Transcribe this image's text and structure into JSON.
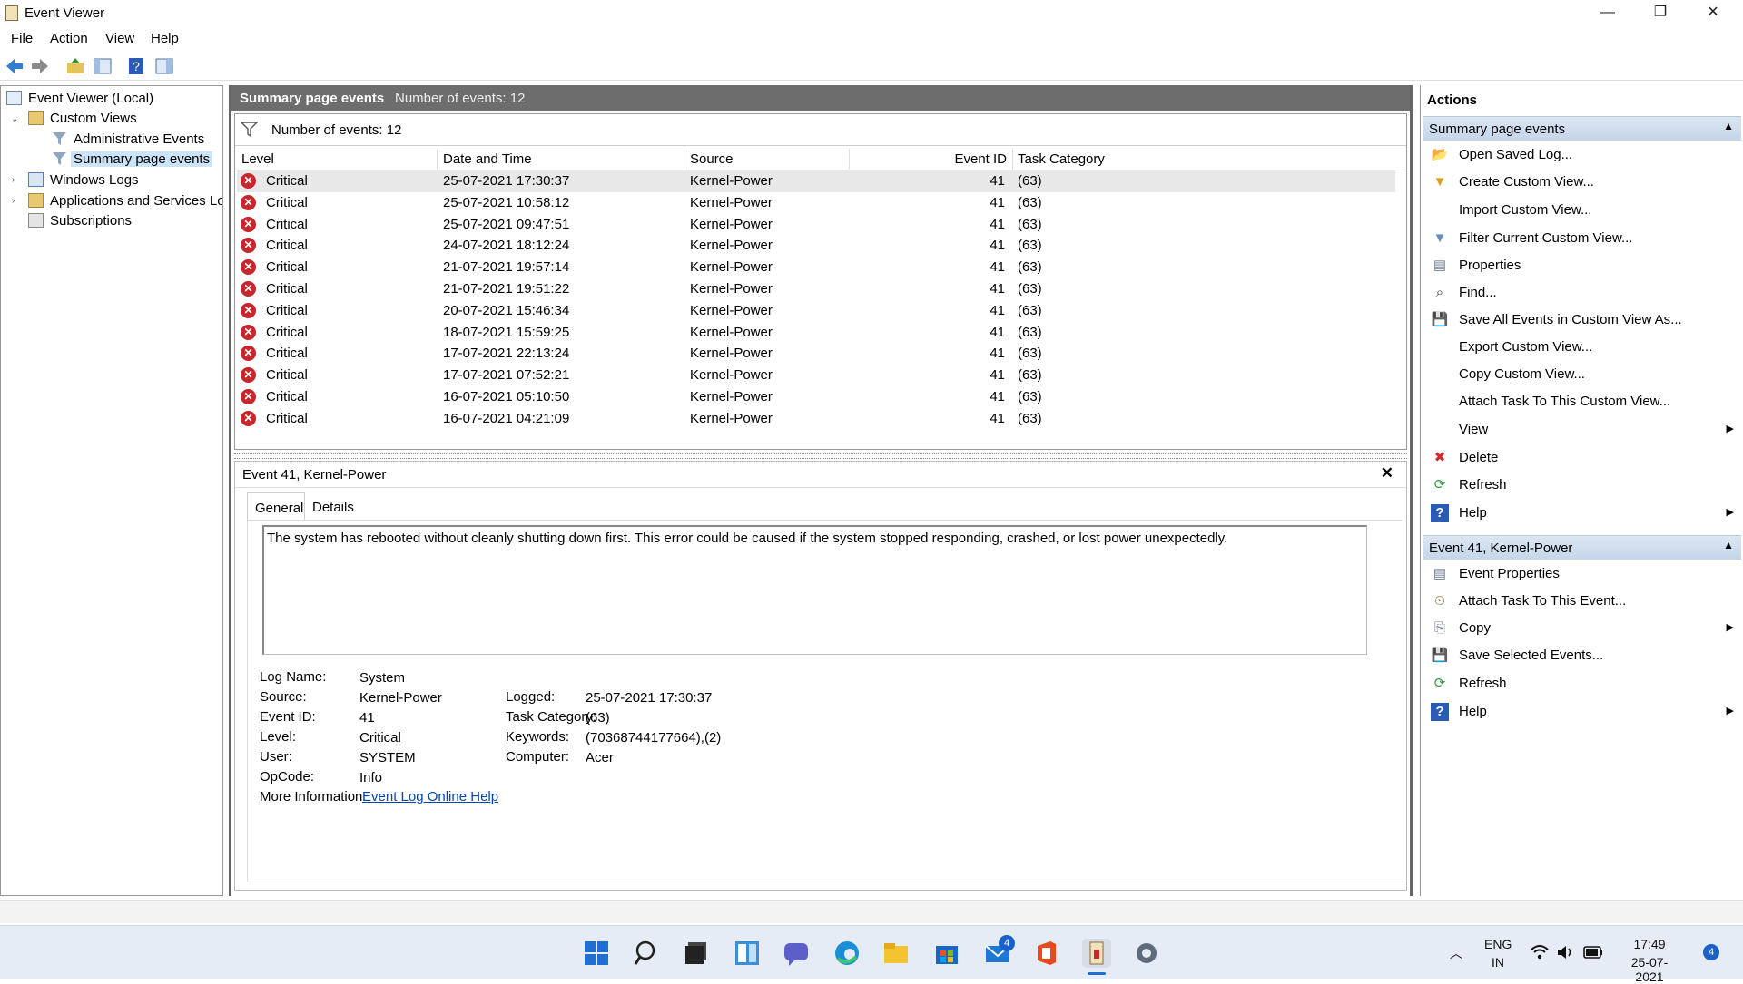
{
  "window": {
    "title": "Event Viewer",
    "controls": {
      "minimize": "—",
      "maximize": "❐",
      "close": "✕"
    }
  },
  "menu": [
    "File",
    "Action",
    "View",
    "Help"
  ],
  "tree": {
    "root": "Event Viewer (Local)",
    "custom_views": "Custom Views",
    "admin_events": "Administrative Events",
    "summary_events": "Summary page events",
    "windows_logs": "Windows Logs",
    "apps_services": "Applications and Services Logs",
    "subscriptions": "Subscriptions"
  },
  "center": {
    "header_title": "Summary page events",
    "header_count": "Number of events: 12",
    "filter_label": "Number of events: 12",
    "columns": [
      "Level",
      "Date and Time",
      "Source",
      "Event ID",
      "Task Category"
    ],
    "rows": [
      [
        "Critical",
        "25-07-2021 17:30:37",
        "Kernel-Power",
        "41",
        "(63)"
      ],
      [
        "Critical",
        "25-07-2021 10:58:12",
        "Kernel-Power",
        "41",
        "(63)"
      ],
      [
        "Critical",
        "25-07-2021 09:47:51",
        "Kernel-Power",
        "41",
        "(63)"
      ],
      [
        "Critical",
        "24-07-2021 18:12:24",
        "Kernel-Power",
        "41",
        "(63)"
      ],
      [
        "Critical",
        "21-07-2021 19:57:14",
        "Kernel-Power",
        "41",
        "(63)"
      ],
      [
        "Critical",
        "21-07-2021 19:51:22",
        "Kernel-Power",
        "41",
        "(63)"
      ],
      [
        "Critical",
        "20-07-2021 15:46:34",
        "Kernel-Power",
        "41",
        "(63)"
      ],
      [
        "Critical",
        "18-07-2021 15:59:25",
        "Kernel-Power",
        "41",
        "(63)"
      ],
      [
        "Critical",
        "17-07-2021 22:13:24",
        "Kernel-Power",
        "41",
        "(63)"
      ],
      [
        "Critical",
        "17-07-2021 07:52:21",
        "Kernel-Power",
        "41",
        "(63)"
      ],
      [
        "Critical",
        "16-07-2021 05:10:50",
        "Kernel-Power",
        "41",
        "(63)"
      ],
      [
        "Critical",
        "16-07-2021 04:21:09",
        "Kernel-Power",
        "41",
        "(63)"
      ]
    ]
  },
  "detail": {
    "title": "Event 41, Kernel-Power",
    "tabs": [
      "General",
      "Details"
    ],
    "description": "The system has rebooted without cleanly shutting down first. This error could be caused if the system stopped responding, crashed, or lost power unexpectedly.",
    "fields": {
      "log_name_label": "Log Name:",
      "log_name": "System",
      "source_label": "Source:",
      "source": "Kernel-Power",
      "event_id_label": "Event ID:",
      "event_id": "41",
      "level_label": "Level:",
      "level": "Critical",
      "user_label": "User:",
      "user": "SYSTEM",
      "opcode_label": "OpCode:",
      "opcode": "Info",
      "more_info_label": "More Information:",
      "more_info_link": "Event Log Online Help",
      "logged_label": "Logged:",
      "logged": "25-07-2021 17:30:37",
      "task_category_label": "Task Category:",
      "task_category": "(63)",
      "keywords_label": "Keywords:",
      "keywords": "(70368744177664),(2)",
      "computer_label": "Computer:",
      "computer": "Acer"
    }
  },
  "actions": {
    "header": "Actions",
    "section1": "Summary page events",
    "items1": [
      "Open Saved Log...",
      "Create Custom View...",
      "Import Custom View...",
      "Filter Current Custom View...",
      "Properties",
      "Find...",
      "Save All Events in Custom View As...",
      "Export Custom View...",
      "Copy Custom View...",
      "Attach Task To This Custom View...",
      "View",
      "Delete",
      "Refresh",
      "Help"
    ],
    "section2": "Event 41, Kernel-Power",
    "items2": [
      "Event Properties",
      "Attach Task To This Event...",
      "Copy",
      "Save Selected Events...",
      "Refresh",
      "Help"
    ]
  },
  "taskbar": {
    "lang1": "ENG",
    "lang2": "IN",
    "time": "17:49",
    "date": "25-07-2021",
    "mail_badge": "4",
    "notif_badge": "4"
  },
  "colors": {
    "critical": "#c9252c",
    "header_gray": "#6d6d6d",
    "section_blue": "#c5d6ea",
    "link": "#0645ad"
  }
}
